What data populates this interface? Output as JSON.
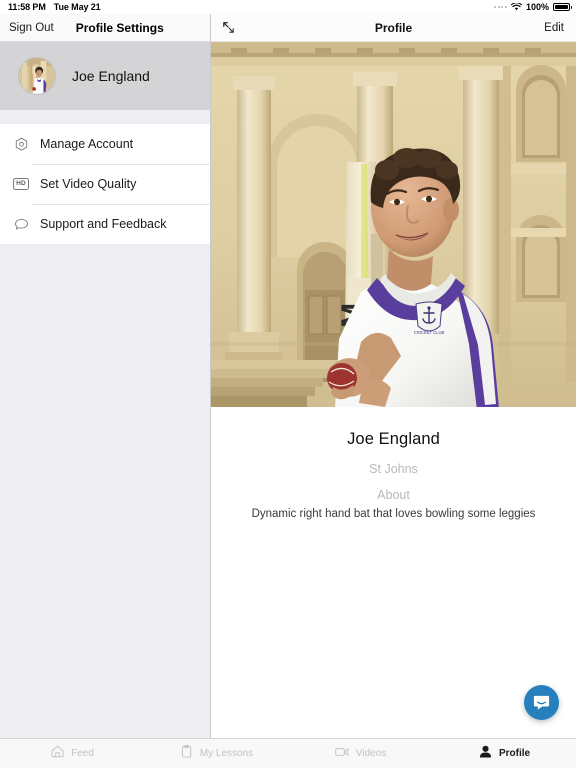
{
  "statusbar": {
    "time": "11:58 PM",
    "date": "Tue May 21",
    "battery_percent": "100%",
    "wifi_icon": "wifi-icon",
    "battery_icon": "battery-full-icon"
  },
  "sidebar": {
    "nav": {
      "sign_out_label": "Sign Out",
      "title": "Profile Settings"
    },
    "profile": {
      "name": "Joe England",
      "avatar_name": "avatar"
    },
    "menu": [
      {
        "label": "Manage Account",
        "icon": "settings-hexagon-icon"
      },
      {
        "label": "Set Video Quality",
        "icon": "hd-icon",
        "icon_text": "HD"
      },
      {
        "label": "Support and Feedback",
        "icon": "chat-bubble-icon"
      }
    ]
  },
  "detail": {
    "nav": {
      "expand_icon": "expand-diagonal-icon",
      "title": "Profile",
      "edit_label": "Edit"
    },
    "hero": {
      "alt": "cricket-player-photo"
    },
    "info": {
      "name": "Joe England",
      "club": "St Johns",
      "about_heading": "About",
      "about_body": "Dynamic right hand bat that loves bowling some leggies"
    },
    "chat": {
      "icon": "intercom-chat-icon",
      "color": "#2680be"
    }
  },
  "tabbar": [
    {
      "label": "Feed",
      "icon": "home-icon",
      "active": false
    },
    {
      "label": "My Lessons",
      "icon": "clipboard-icon",
      "active": false
    },
    {
      "label": "Videos",
      "icon": "video-camera-icon",
      "active": false
    },
    {
      "label": "Profile",
      "icon": "person-filled-icon",
      "active": true
    }
  ]
}
